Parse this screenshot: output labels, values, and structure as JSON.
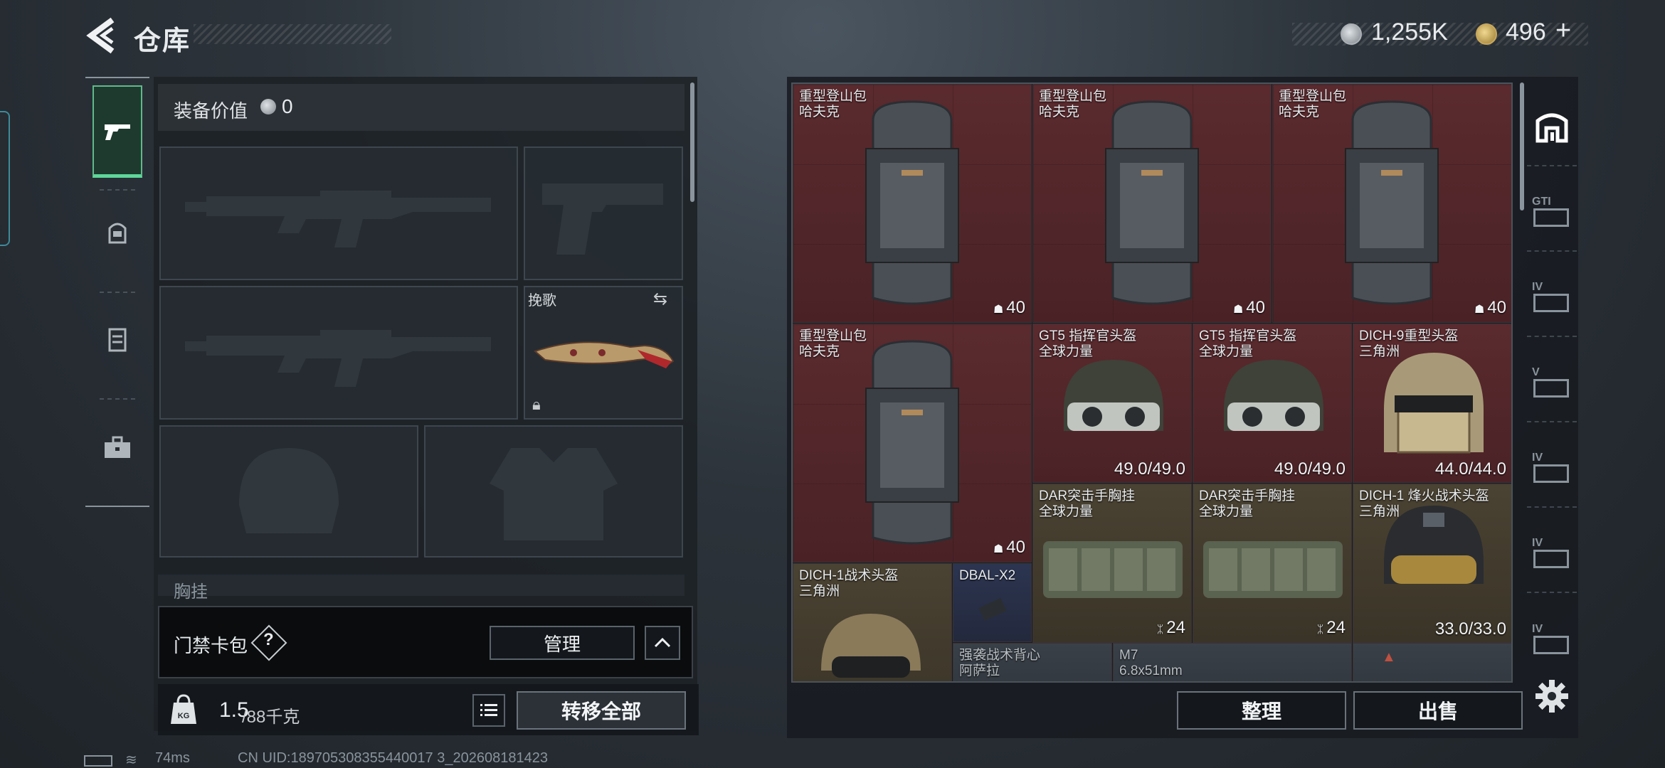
{
  "header": {
    "title": "仓库"
  },
  "currency": {
    "silver": "1,255K",
    "gold": "496",
    "gold_add": "+"
  },
  "loadout": {
    "equip_value_label": "装备价值",
    "equip_value": "0",
    "melee_name": "挽歌",
    "rig_label": "胸挂",
    "keycard_label": "门禁卡包",
    "keycard_help": "?",
    "manage_label": "管理",
    "weight_current": "1.5",
    "weight_max": "/88千克",
    "transfer_all_label": "转移全部"
  },
  "status": {
    "ping": "74ms",
    "uid": "CN UID:189705308355440017 3_202608181423"
  },
  "inventory": {
    "items": [
      {
        "line1": "重型登山包",
        "line2": "哈夫克",
        "stat": "40"
      },
      {
        "line1": "重型登山包",
        "line2": "哈夫克",
        "stat": "40"
      },
      {
        "line1": "重型登山包",
        "line2": "哈夫克",
        "stat": "40"
      },
      {
        "line1": "重型登山包",
        "line2": "哈夫克",
        "stat": "40"
      },
      {
        "line1": "GT5 指挥官头盔",
        "line2": "全球力量",
        "stat": "49.0/49.0"
      },
      {
        "line1": "GT5 指挥官头盔",
        "line2": "全球力量",
        "stat": "49.0/49.0"
      },
      {
        "line1": "DICH-9重型头盔",
        "line2": "三角洲",
        "stat": "44.0/44.0"
      },
      {
        "line1": "DAR突击手胸挂",
        "line2": "全球力量",
        "stat": "24"
      },
      {
        "line1": "DAR突击手胸挂",
        "line2": "全球力量",
        "stat": "24"
      },
      {
        "line1": "DICH-1 烽火战术头盔",
        "line2": "三角洲",
        "stat": "33.0/33.0"
      },
      {
        "line1": "DICH-1战术头盔",
        "line2": "三角洲",
        "stat": ""
      },
      {
        "line1": "DBAL-X2",
        "line2": "",
        "stat": ""
      },
      {
        "line1": "强袭战术背心",
        "line2": "阿萨拉",
        "stat": ""
      },
      {
        "line1": "M7",
        "line2": "6.8x51mm",
        "stat": ""
      }
    ],
    "sort_label": "整理",
    "sell_label": "出售"
  },
  "right_tabs": [
    "",
    "GTI",
    "IV",
    "V",
    "IV",
    "IV",
    "IV"
  ],
  "colors": {
    "rare_red": "#5a2a2e",
    "olive": "#4a4232",
    "accent_green": "#5fd69a"
  }
}
